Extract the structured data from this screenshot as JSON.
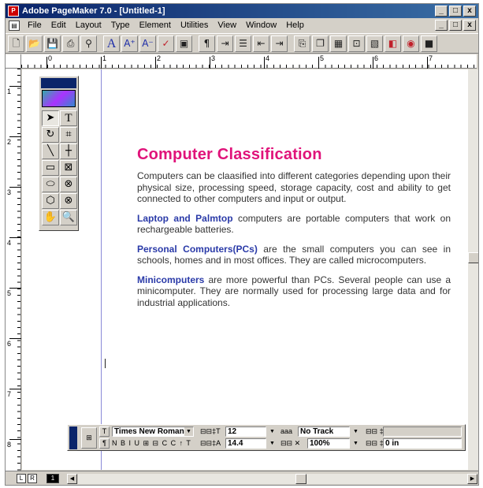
{
  "window": {
    "title": "Adobe PageMaker 7.0 - [Untitled-1]"
  },
  "menubar": {
    "items": [
      "File",
      "Edit",
      "Layout",
      "Type",
      "Element",
      "Utilities",
      "View",
      "Window",
      "Help"
    ]
  },
  "window_buttons": {
    "minimize": "_",
    "restore": "□",
    "close": "x"
  },
  "toolbar": {
    "icons": [
      "new-icon",
      "open-icon",
      "save-icon",
      "print-icon",
      "find-icon",
      "font-icon",
      "font-larger-icon",
      "font-smaller-icon",
      "spelling-icon",
      "style-icon",
      "paragraph-icon",
      "tab-icon",
      "bullets-icon",
      "outdent-icon",
      "indent-icon",
      "place-icon",
      "copy-icon",
      "frame-icon",
      "links-icon",
      "image-icon",
      "color-icon",
      "help-icon",
      "more-icon"
    ]
  },
  "hruler": {
    "labels": [
      "0",
      "1",
      "2",
      "3",
      "4",
      "5",
      "6",
      "7"
    ]
  },
  "vruler": {
    "labels": [
      "1",
      "2",
      "3",
      "4",
      "5",
      "6",
      "7",
      "8"
    ]
  },
  "toolbox": {
    "tools": [
      "pointer-tool",
      "text-tool",
      "rotate-tool",
      "crop-tool",
      "line-tool",
      "constrained-line-tool",
      "rectangle-tool",
      "rectangle-frame-tool",
      "ellipse-tool",
      "ellipse-frame-tool",
      "polygon-tool",
      "polygon-frame-tool",
      "hand-tool",
      "zoom-tool"
    ]
  },
  "document": {
    "heading": "Computer Classification",
    "intro": "Computers can be claasified into different categories depending upon their physical size, processing speed, storage capacity, cost and ability to get connected to other computers and input or output.",
    "para1_bold": "Laptop and Palmtop",
    "para1_rest": " computers are portable computers that work on rechargeable batteries.",
    "para2_bold": "Personal Computers(PCs)",
    "para2_rest": " are the small computers you can see in schools, homes and in most offices. They are called microcomputers.",
    "para3_bold": "Minicomputers",
    "para3_rest": " are more powerful than PCs. Several people can use a minicomputer. They are normally used for processing large data and for industrial applications."
  },
  "control_palette": {
    "font": "Times New Roman",
    "size": "12",
    "leading": "14.4",
    "tracking": "No Track",
    "scale": "100%",
    "indent": "0 in",
    "style_buttons": "N B I U ⊞ ⊟ C C ↑ T"
  },
  "pages": {
    "left": "L",
    "right": "R",
    "page1": "1"
  }
}
